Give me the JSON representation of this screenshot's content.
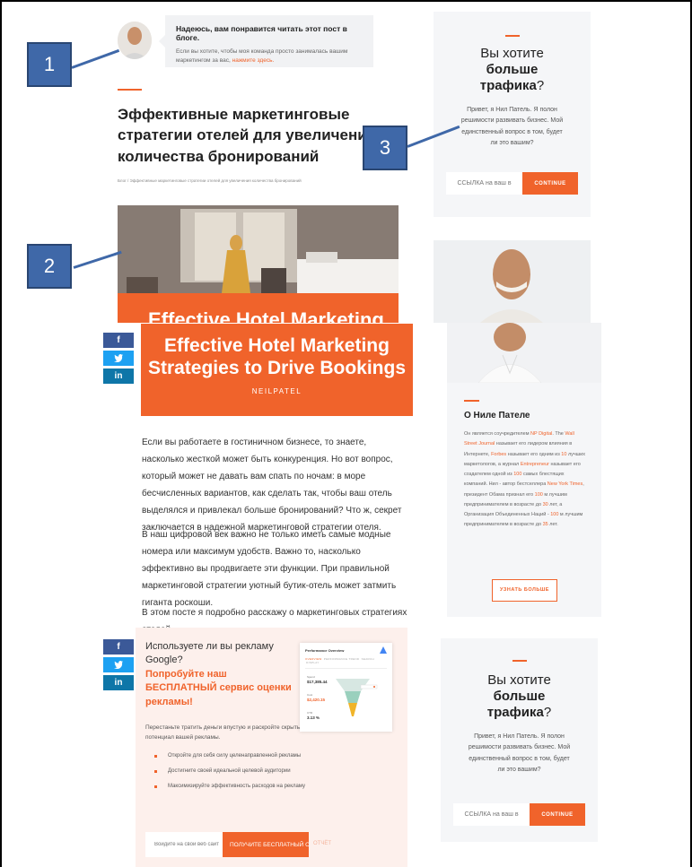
{
  "author_note": {
    "title": "Надеюсь, вам понравится читать этот пост в блоге.",
    "text": "Если вы хотите, чтобы моя команда просто занималась вашим маркетингом за вас,",
    "link": "нажмите здесь."
  },
  "post": {
    "title": "Эффективные маркетинговые стратегии отелей для увеличения количества бронирований",
    "breadcrumb": "Блог / Эффективные маркетинговые стратегии отелей для увеличения количества бронирований",
    "hero_ghost": "Effective Hotel Marketing",
    "hero_line1": "Effective Hotel Marketing",
    "hero_line2": "Strategies to Drive Bookings",
    "hero_brand": "NEILPATEL",
    "paragraphs": [
      "Если вы работаете в гостиничном бизнесе, то знаете, насколько жесткой может быть конкуренция. Но вот вопрос, который может не давать вам спать по ночам: в море бесчисленных вариантов, как сделать так, чтобы ваш отель выделялся и привлекал больше бронирований? Что ж, секрет заключается в надежной маркетинговой стратегии отеля.",
      "В наш цифровой век важно не только иметь самые модные номера или максимум удобств. Важно то, насколько эффективно вы продвигаете эти функции. При правильной маркетинговой стратегии уютный бутик-отель может затмить гиганта роскоши.",
      "В этом посте я подробно расскажу о маркетинговых стратегиях отелей,"
    ]
  },
  "share": {
    "facebook": "f",
    "twitter": "🐦",
    "linkedin": "in"
  },
  "ad": {
    "question": "Используете ли вы рекламу Google?",
    "offer": "Попробуйте наш БЕСПЛАТНЫЙ сервис оценки рекламы!",
    "text": "Перестаньте тратить деньги впустую и раскройте скрытый потенциал вашей рекламы.",
    "bullets": [
      "Откройте для себя силу целенаправленной рекламы",
      "Достигните своей идеальной целевой аудитории",
      "Максимизируйте эффективность расходов на рекламу"
    ],
    "input_placeholder": "Войдите на свой веб сайт",
    "button": "ПОЛУЧИТЕ БЕСПЛАТНЫЙ ОТЧЁТ",
    "button_ghost": "ОТЧЁТ",
    "preview_title": "Performance Overview",
    "preview_tabs": [
      "OVERVIEW",
      "PERFORMANCE TREND",
      "SEARCH",
      "DISPLAY"
    ],
    "preview_stats": [
      {
        "label": "Spend",
        "value": "$17,385.44"
      },
      {
        "label": "Cost",
        "value": "$2,420.15"
      },
      {
        "label": "CTR",
        "value": "3.13 %"
      }
    ]
  },
  "cta": {
    "heading_line1": "Вы хотите",
    "heading_bold": "больше",
    "heading_line3": "трафика",
    "heading_q": "?",
    "text": "Привет, я Нил Патель. Я полон решимости развивать бизнес. Мой единственный вопрос в том, будет ли это вашим?",
    "input_placeholder": "ССЫЛКА на ваш в",
    "button": "CONTINUE"
  },
  "about": {
    "name": "О Ниле Пателе",
    "bio_parts": [
      {
        "t": "Он является соучредителем ",
        "o": false
      },
      {
        "t": "NP Digital",
        "o": true
      },
      {
        "t": ". The ",
        "o": false
      },
      {
        "t": "Wall Street Journal",
        "o": true
      },
      {
        "t": " называет его лидером влияния в Интернете, ",
        "o": false
      },
      {
        "t": "Forbes",
        "o": true
      },
      {
        "t": " называет его одним из ",
        "o": false
      },
      {
        "t": "10",
        "o": true
      },
      {
        "t": " лучших маркетологов, а журнал ",
        "o": false
      },
      {
        "t": "Entrepreneur",
        "o": true
      },
      {
        "t": " называет его создателем одной из ",
        "o": false
      },
      {
        "t": "100",
        "o": true
      },
      {
        "t": " самых блестящих компаний. Нил - автор бестселлера ",
        "o": false
      },
      {
        "t": "New York Times",
        "o": true
      },
      {
        "t": ", президент Обама признал его ",
        "o": false
      },
      {
        "t": "100",
        "o": true
      },
      {
        "t": " м лучшим предпринимателем в возрасте до ",
        "o": false
      },
      {
        "t": "30",
        "o": true
      },
      {
        "t": " лет, а Организация Объединенных Наций - ",
        "o": false
      },
      {
        "t": "100",
        "o": true
      },
      {
        "t": " м лучшим предпринимателем в возрасте до ",
        "o": false
      },
      {
        "t": "35",
        "o": true
      },
      {
        "t": " лет.",
        "o": false
      }
    ],
    "button": "УЗНАТЬ БОЛЬШЕ"
  },
  "callouts": [
    "1",
    "2",
    "3"
  ],
  "colors": {
    "accent": "#f0632b",
    "callout": "#3f68a8"
  }
}
